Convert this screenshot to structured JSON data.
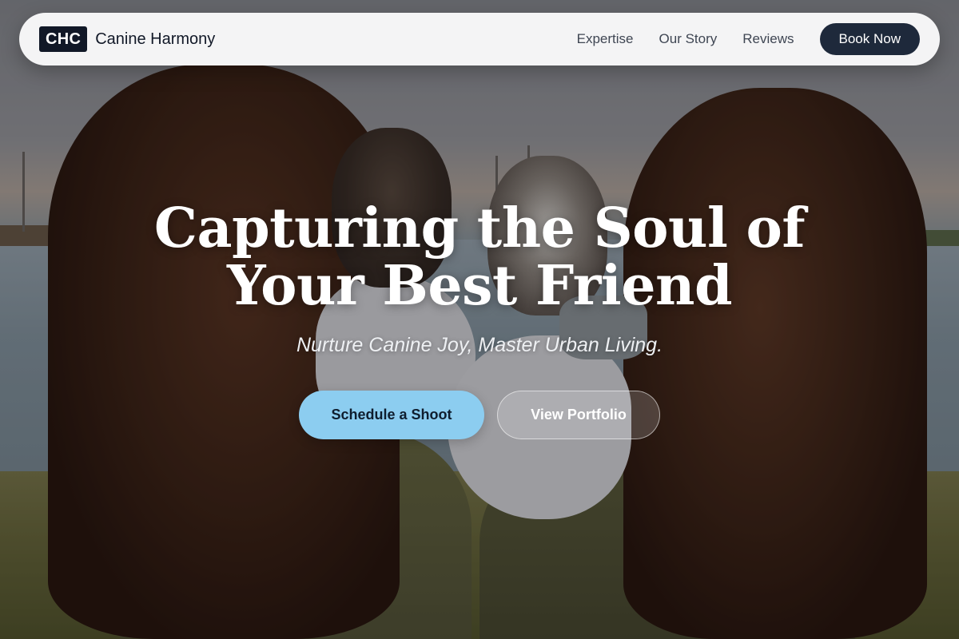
{
  "nav": {
    "logo_mark": "CHC",
    "brand_name": "Canine Harmony",
    "links": [
      {
        "label": "Expertise"
      },
      {
        "label": "Our Story"
      },
      {
        "label": "Reviews"
      }
    ],
    "cta_label": "Book Now"
  },
  "hero": {
    "headline_line1": "Capturing the Soul of",
    "headline_line2": "Your Best Friend",
    "tagline": "Nurture Canine Joy, Master Urban Living.",
    "primary_cta": "Schedule a Shoot",
    "secondary_cta": "View Portfolio",
    "background_image": "two-women-holding-french-bulldogs-by-lake"
  },
  "colors": {
    "nav_bg": "#f4f4f5",
    "logo_bg": "#111827",
    "book_btn_bg": "#1e293b",
    "primary_cta_bg": "#8ccdf0",
    "text_dark": "#111827"
  }
}
